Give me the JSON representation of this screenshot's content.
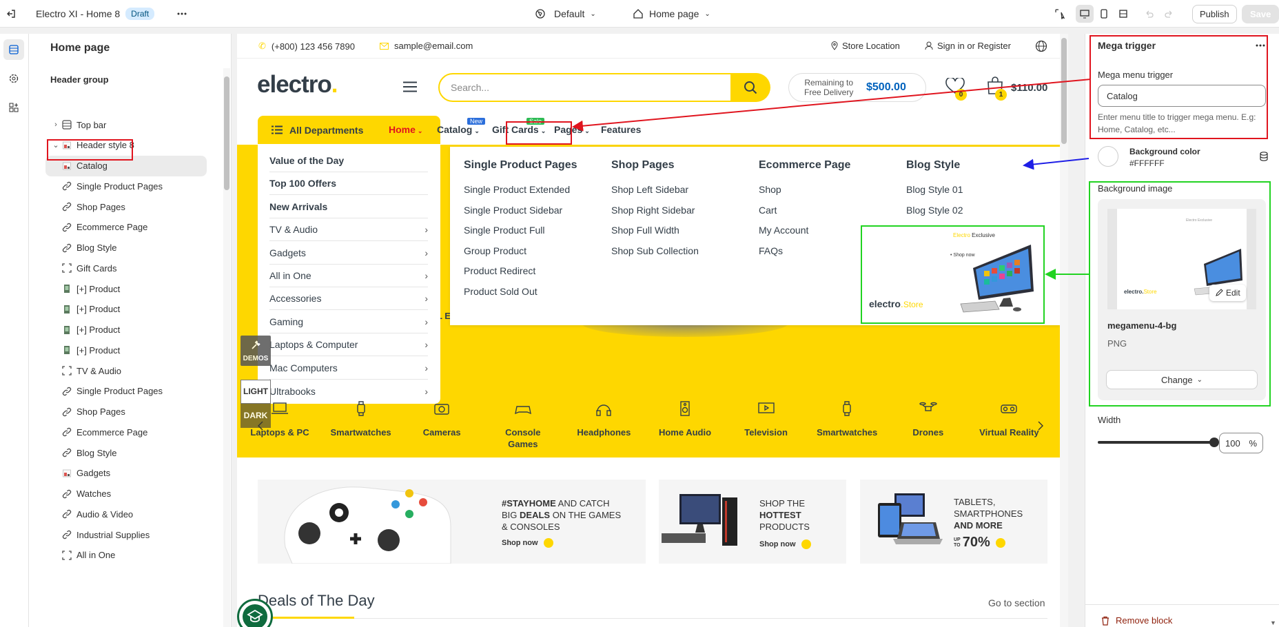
{
  "topbar": {
    "title": "Electro XI - Home 8",
    "draft": "Draft",
    "theme": "Default",
    "page": "Home page",
    "publish": "Publish",
    "save": "Save"
  },
  "sidebar": {
    "title": "Home page",
    "group": "Header group",
    "items": [
      {
        "label": "Top bar",
        "icon": "layout-icon"
      },
      {
        "label": "Header style 8",
        "icon": "image-icon"
      },
      {
        "label": "Catalog",
        "icon": "image-icon"
      },
      {
        "label": "Single Product Pages",
        "icon": "link-icon"
      },
      {
        "label": "Shop Pages",
        "icon": "link-icon"
      },
      {
        "label": "Ecommerce Page",
        "icon": "link-icon"
      },
      {
        "label": "Blog Style",
        "icon": "link-icon"
      },
      {
        "label": "Gift Cards",
        "icon": "collection-icon"
      },
      {
        "label": "[+] Product",
        "icon": "product-thumb-icon"
      },
      {
        "label": "[+] Product",
        "icon": "product-thumb-icon"
      },
      {
        "label": "[+] Product",
        "icon": "product-thumb-icon"
      },
      {
        "label": "[+] Product",
        "icon": "product-thumb-icon"
      },
      {
        "label": "TV & Audio",
        "icon": "collection-icon"
      },
      {
        "label": "Single Product Pages",
        "icon": "link-icon"
      },
      {
        "label": "Shop Pages",
        "icon": "link-icon"
      },
      {
        "label": "Ecommerce Page",
        "icon": "link-icon"
      },
      {
        "label": "Blog Style",
        "icon": "link-icon"
      },
      {
        "label": "Gadgets",
        "icon": "image-icon"
      },
      {
        "label": "Watches",
        "icon": "link-icon"
      },
      {
        "label": "Audio & Video",
        "icon": "link-icon"
      },
      {
        "label": "Industrial Supplies",
        "icon": "link-icon"
      },
      {
        "label": "All in One",
        "icon": "collection-icon"
      }
    ]
  },
  "store": {
    "phone": "(+800) 123 456 7890",
    "email": "sample@email.com",
    "store_location": "Store Location",
    "sign_in": "Sign in or Register",
    "logo": "electro",
    "logo_dot": ".",
    "search_placeholder": "Search...",
    "remaining_line1": "Remaining to",
    "remaining_line2": "Free Delivery",
    "remaining_amount": "$500.00",
    "wishlist_count": "0",
    "cart_count": "1",
    "cart_total": "$110.00",
    "all_departments": "All Departments",
    "nav": [
      {
        "label": "Home",
        "badge": ""
      },
      {
        "label": "Catalog",
        "badge": "New"
      },
      {
        "label": "Gift Cards",
        "badge": "Sale"
      },
      {
        "label": "Pages",
        "badge": ""
      },
      {
        "label": "Features",
        "badge": ""
      }
    ],
    "departments": [
      {
        "label": "Value of the Day",
        "bold": true
      },
      {
        "label": "Top 100 Offers",
        "bold": true
      },
      {
        "label": "New Arrivals",
        "bold": true
      },
      {
        "label": "TV & Audio",
        "bold": false
      },
      {
        "label": "Gadgets",
        "bold": false
      },
      {
        "label": "All in One",
        "bold": false
      },
      {
        "label": "Accessories",
        "bold": false
      },
      {
        "label": "Gaming",
        "bold": false
      },
      {
        "label": "Laptops & Computer",
        "bold": false
      },
      {
        "label": "Mac Computers",
        "bold": false
      },
      {
        "label": "Ultrabooks",
        "bold": false
      }
    ],
    "mega_columns": [
      {
        "title": "Single Product Pages",
        "links": [
          "Single Product Extended",
          "Single Product Sidebar",
          "Single Product Full",
          "Group Product",
          "Product Redirect",
          "Product Sold Out"
        ]
      },
      {
        "title": "Shop Pages",
        "links": [
          "Shop Left Sidebar",
          "Shop Right Sidebar",
          "Shop Full Width",
          "Shop Sub Collection"
        ]
      },
      {
        "title": "Ecommerce Page",
        "links": [
          "Shop",
          "Cart",
          "My Account",
          "FAQs"
        ]
      },
      {
        "title": "Blog Style",
        "links": [
          "Blog Style 01",
          "Blog Style 02"
        ]
      }
    ],
    "promo_exclusive": "Exclusive",
    "promo_brand": "Electro",
    "promo_shop": "• Shop now",
    "promo_logo": "electro",
    "promo_logo2": "Store",
    "hero_partial": "LL END",
    "demos": "DEMOS",
    "light": "LIGHT",
    "dark": "DARK",
    "categories": [
      "Laptops & PC",
      "Smartwatches",
      "Cameras",
      "Console Games",
      "Headphones",
      "Home Audio",
      "Television",
      "Smartwatches",
      "Drones",
      "Virtual Reality"
    ],
    "banners": [
      {
        "l1a": "#STAYHOME",
        "l1b": " AND CATCH",
        "l2a": "BIG ",
        "l2b": "DEALS",
        "l2c": " ON THE GAMES",
        "l3": "& CONSOLES",
        "cta": "Shop now"
      },
      {
        "l1": "SHOP THE",
        "l2": "HOTTEST",
        "l3": "PRODUCTS",
        "cta": "Shop now"
      },
      {
        "l1": "TABLETS,",
        "l2": "SMARTPHONES",
        "l3": "AND MORE",
        "upto1": "UP",
        "upto2": "TO",
        "pct": "70%"
      }
    ],
    "deals_title": "Deals of The Day",
    "go_to_section": "Go to section"
  },
  "panel": {
    "title": "Mega trigger",
    "field_label": "Mega menu trigger",
    "field_value": "Catalog",
    "help": "Enter menu title to trigger mega menu. E.g: Home, Catalog, etc...",
    "bg_color_label": "Background color",
    "bg_color_value": "#FFFFFF",
    "bg_image_label": "Background image",
    "edit": "Edit",
    "file_name": "megamenu-4-bg",
    "file_type": "PNG",
    "change": "Change",
    "width_label": "Width",
    "width_value": "100",
    "width_unit": "%",
    "width_fraction": 1.0,
    "remove": "Remove block"
  },
  "colors": {
    "accent": "#fed700",
    "brand": "#333e48",
    "red": "#e0141e",
    "green": "#21d321",
    "blue": "#1e1ee6",
    "price": "#0062bd"
  }
}
